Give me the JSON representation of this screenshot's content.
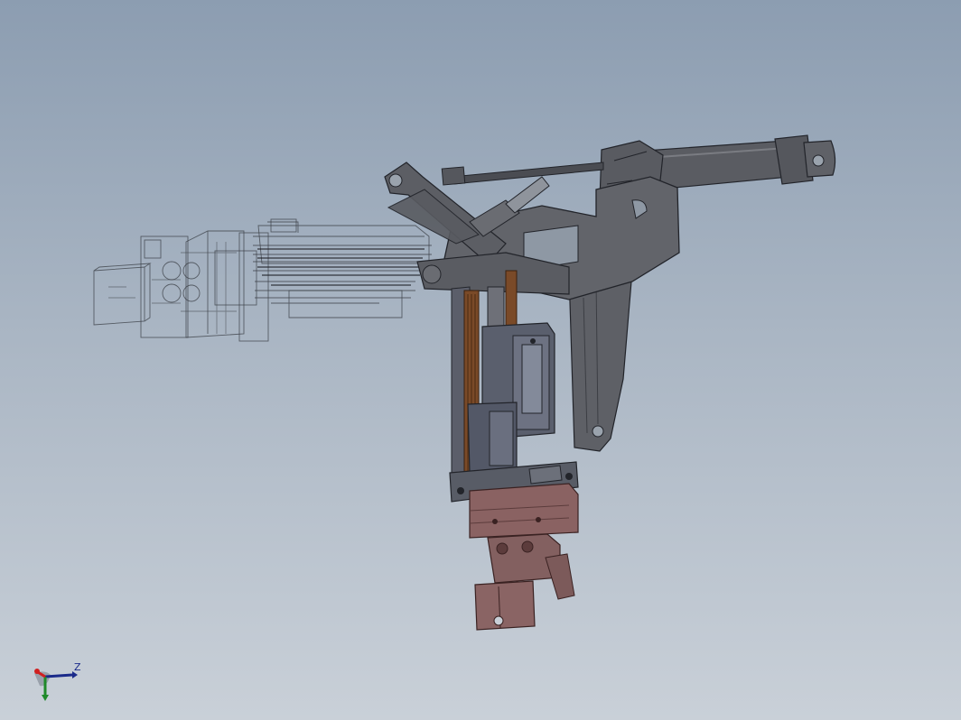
{
  "viewport": {
    "background_top": "#8c9db1",
    "background_bottom": "#c9d0d8"
  },
  "model": {
    "opaque_color": "#5e6066",
    "transparent_edge_color": "#3a3d44",
    "carriage_color": "#5a5f6d",
    "gripper_color": "#8a6262",
    "slide_rail_color": "#7a4a28"
  },
  "triad": {
    "z_label": "Z",
    "x_axis_color": "#d02020",
    "y_axis_color": "#1f8a2a",
    "z_axis_color": "#1a2a8a"
  }
}
